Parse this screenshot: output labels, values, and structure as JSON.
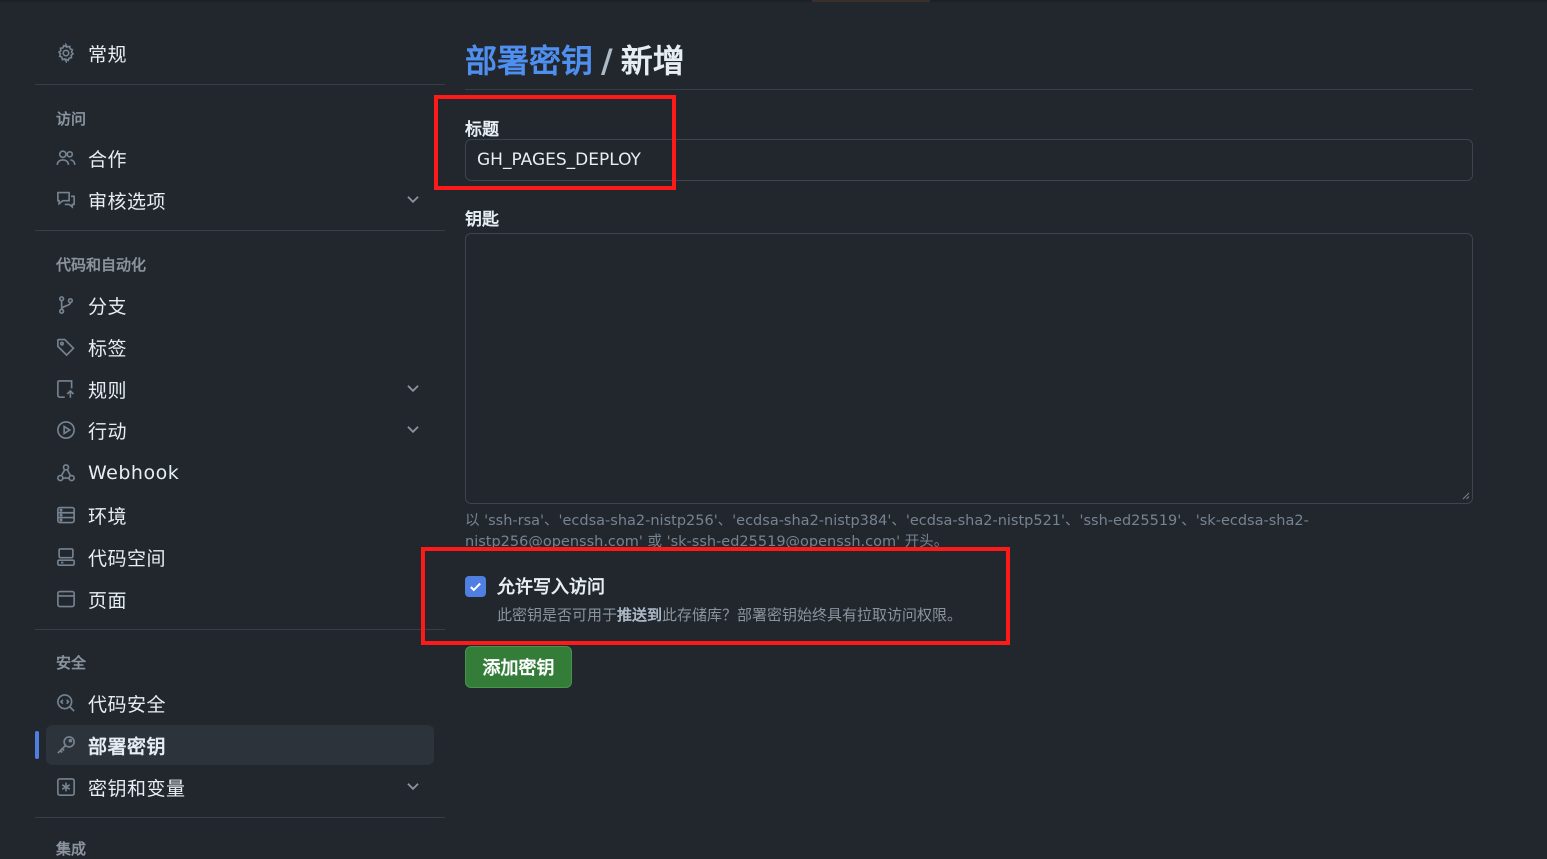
{
  "sidebar": {
    "general": "常规",
    "sections": {
      "access": "访问",
      "code_automation": "代码和自动化",
      "security": "安全",
      "integrations": "集成"
    },
    "items": {
      "collaborators": "合作",
      "moderation": "审核选项",
      "branches": "分支",
      "tags": "标签",
      "rules": "规则",
      "actions": "行动",
      "webhooks": "Webhook",
      "environments": "环境",
      "codespaces": "代码空间",
      "pages": "页面",
      "code_security": "代码安全",
      "deploy_keys": "部署密钥",
      "secrets": "密钥和变量"
    },
    "selected": "deploy_keys"
  },
  "main": {
    "breadcrumb_link": "部署密钥",
    "breadcrumb_sep": "/",
    "breadcrumb_current": "新增",
    "title_label": "标题",
    "title_value": "GH_PAGES_DEPLOY",
    "key_label": "钥匙",
    "key_value": "",
    "help_text": "以 'ssh-rsa'、'ecdsa-sha2-nistp256'、'ecdsa-sha2-nistp384'、'ecdsa-sha2-nistp521'、'ssh-ed25519'、'sk-ecdsa-sha2-nistp256@openssh.com' 或 'sk-ssh-ed25519@openssh.com' 开头。",
    "write_access_label": "允许写入访问",
    "write_access_checked": true,
    "write_access_desc_pre": "此密钥是否可用于",
    "write_access_desc_bold": "推送到",
    "write_access_desc_post": "此存储库？部署密钥始终具有拉取访问权限。",
    "submit_label": "添加密钥"
  },
  "colors": {
    "background": "#22272e",
    "accent_blue": "#4f80e1",
    "link_blue": "#4f8ff0",
    "button_green": "#347d39",
    "annotation_red": "#ff1a1a"
  }
}
